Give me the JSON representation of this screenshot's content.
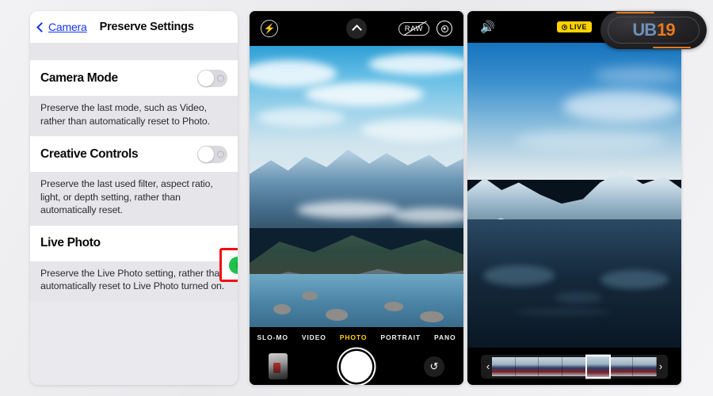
{
  "settings": {
    "nav": {
      "back_label": "Camera",
      "back_icon": "chevron-left-icon",
      "title": "Preserve Settings"
    },
    "rows": [
      {
        "label": "Camera Mode",
        "toggle_state": "off",
        "description": "Preserve the last mode, such as Video, rather than automatically reset to Photo."
      },
      {
        "label": "Creative Controls",
        "toggle_state": "off",
        "description": "Preserve the last used filter, aspect ratio, light, or depth setting, rather than automatically reset."
      },
      {
        "label": "Live Photo",
        "toggle_state": "on",
        "description": "Preserve the Live Photo setting, rather than automatically reset to Live Photo turned on."
      }
    ],
    "highlight_color": "#f20d0d",
    "toggle_on_color": "#1ec24a",
    "toggle_off_color": "#d9d9de",
    "link_color": "#1436e8"
  },
  "camera": {
    "top_bar": {
      "flash_icon": "flash-bolt-icon",
      "expand_icon": "chevron-up-icon",
      "raw_label": "RAW",
      "raw_state": "disabled",
      "live_photo_icon": "live-photo-circle-icon"
    },
    "modes": [
      {
        "label": "SLO-MO",
        "active": false
      },
      {
        "label": "VIDEO",
        "active": false
      },
      {
        "label": "PHOTO",
        "active": true
      },
      {
        "label": "PORTRAIT",
        "active": false
      },
      {
        "label": "PANO",
        "active": false
      }
    ],
    "active_mode_color": "#ffd200",
    "bottom_bar": {
      "thumbnail_icon": "last-photo-thumbnail",
      "shutter_icon": "shutter-button",
      "flip_icon": "camera-flip-icon",
      "flip_glyph": "↺"
    },
    "scene": "snow capped mountain range with rocky foreground and water"
  },
  "photo_viewer": {
    "top_bar": {
      "sound_icon": "speaker-on-icon",
      "sound_glyph": "🔊",
      "live_badge_label": "LIVE",
      "live_badge_icon": "live-photo-circle-icon",
      "live_badge_color": "#ffd200"
    },
    "scrubber": {
      "prev_glyph": "‹",
      "next_glyph": "›",
      "frame_count": 7,
      "selected_frame_index": 4
    },
    "scene": "icebergs and snowy peaks reflected in dark still water"
  },
  "watermark": {
    "text_blue": "UB",
    "text_orange": "19",
    "blue": "#6f8fb5",
    "orange": "#e8791e"
  }
}
